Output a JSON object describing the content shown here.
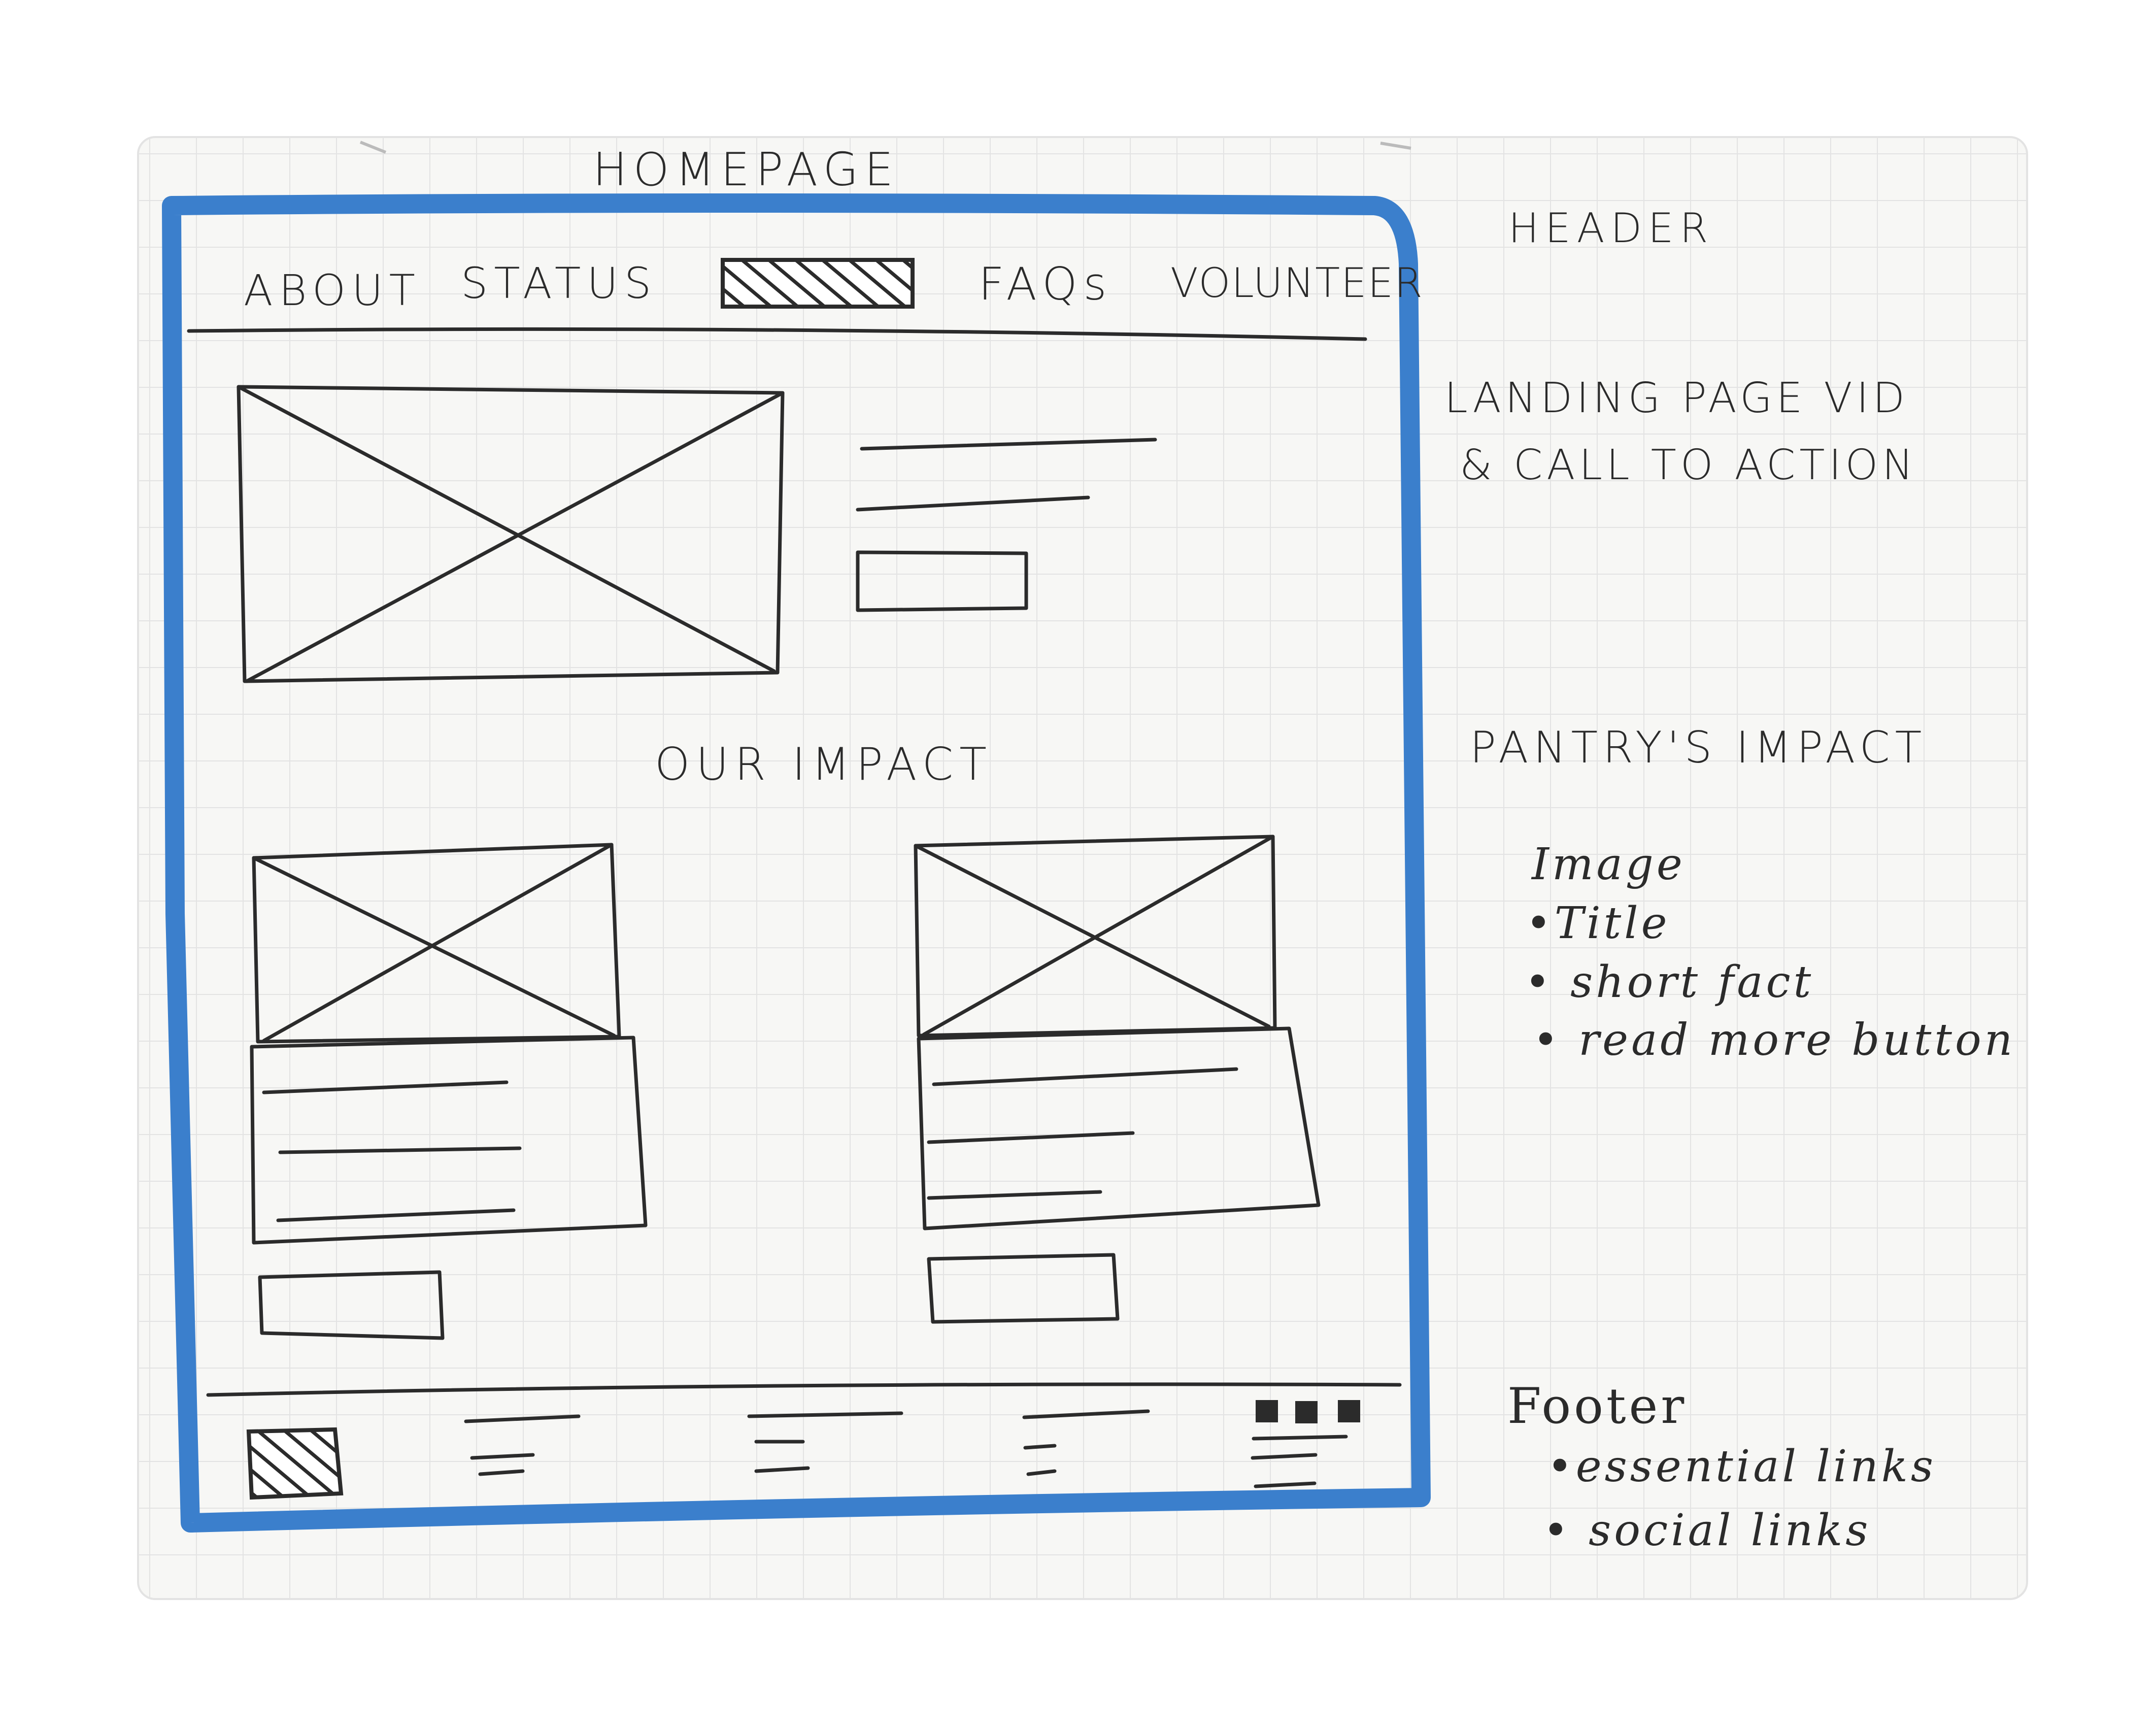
{
  "sketch_title": "HOMEPAGE",
  "nav": {
    "about": "ABOUT",
    "status": "STATUS",
    "faqs": "FAQs",
    "volunteer": "VOLUNTEER"
  },
  "section_heading": "OUR IMPACT",
  "annotations": {
    "header": "HEADER",
    "landing_line1": "LANDING PAGE VID",
    "landing_line2": "& CALL TO ACTION",
    "impact_title": "PANTRY'S IMPACT",
    "impact_items": [
      "Image",
      "•Title",
      "• short fact",
      "• read more button"
    ],
    "footer_title": "Footer",
    "footer_items": [
      "•essential links",
      "• social links"
    ]
  },
  "colors": {
    "frame_blue": "#3b7fcc",
    "ink": "#2b2b2b",
    "grid": "#e3e3e3"
  }
}
